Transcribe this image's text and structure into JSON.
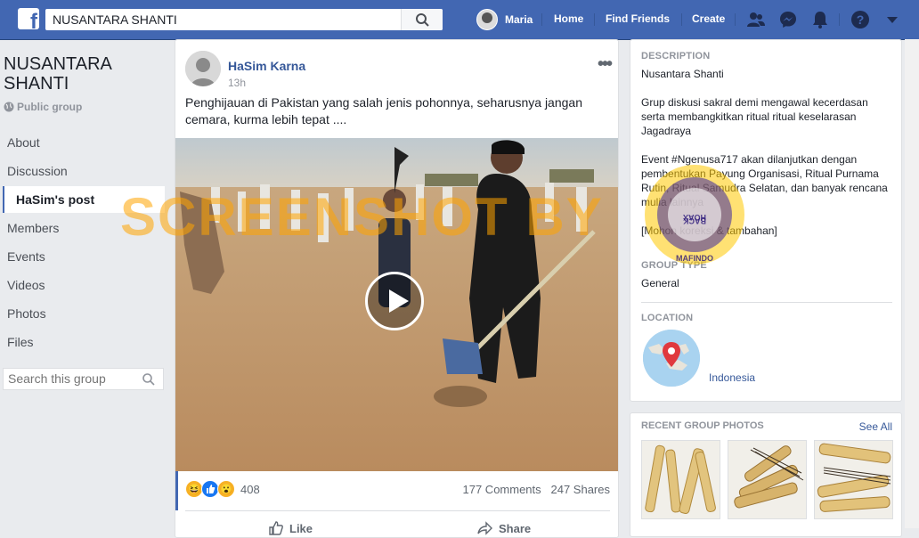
{
  "topbar": {
    "search_value": "NUSANTARA SHANTI",
    "user_name": "Maria",
    "home": "Home",
    "find_friends": "Find Friends",
    "create": "Create"
  },
  "group": {
    "name": "NUSANTARA SHANTI",
    "privacy": "Public group",
    "menu": [
      "About",
      "Discussion",
      "HaSim's post",
      "Members",
      "Events",
      "Videos",
      "Photos",
      "Files"
    ],
    "search_placeholder": "Search this group"
  },
  "post": {
    "author": "HaSim Karna",
    "time": "13h",
    "text": "Penghijauan di Pakistan yang salah jenis pohonnya, seharusnya jangan cemara, kurma lebih tepat ....",
    "reaction_count": "408",
    "comments": "177 Comments",
    "shares": "247 Shares",
    "like_label": "Like",
    "share_label": "Share"
  },
  "sidebar": {
    "description_label": "DESCRIPTION",
    "description_text": "Nusantara Shanti\n\nGrup diskusi sakral demi mengawal kecerdasan serta membangkitkan ritual ritual keselarasan Jagadraya\n\nEvent #Ngenusa717 akan dilanjutkan dengan pembentukan Payung Organisasi, Ritual Purnama Rutin, Ritual Samudra Selatan, dan banyak rencana mulia lainnya\n\n[Mohon koreksi & tambahan]",
    "group_type_label": "GROUP TYPE",
    "group_type": "General",
    "location_label": "LOCATION",
    "location": "Indonesia",
    "recent_photos_label": "RECENT GROUP PHOTOS",
    "see_all": "See All"
  },
  "watermark": {
    "text": "SCREENSHOT BY",
    "badge_top": "TURN BACK HOAX",
    "badge_bottom": "MAFINDO"
  },
  "colors": {
    "brand_blue": "#4267b2",
    "link_blue": "#365899",
    "watermark_orange": "#ffa400"
  }
}
